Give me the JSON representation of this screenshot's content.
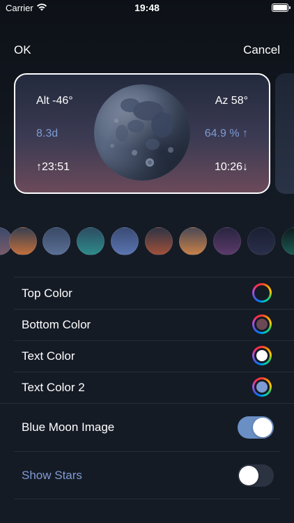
{
  "status_bar": {
    "carrier": "Carrier",
    "time": "19:48"
  },
  "nav": {
    "ok_label": "OK",
    "cancel_label": "Cancel"
  },
  "widget": {
    "altitude": "Alt -46°",
    "azimuth": "Az 58°",
    "moon_age": "8.3d",
    "illumination": "64.9 % ↑",
    "moonrise": "↑23:51",
    "moonset": "10:26↓"
  },
  "presets": [
    {
      "name": "preset-1",
      "top": "#3b4a6b",
      "bottom": "#7a5a6a"
    },
    {
      "name": "preset-2",
      "top": "#3a4050",
      "bottom": "#c26f3c"
    },
    {
      "name": "preset-3",
      "top": "#3a4a66",
      "bottom": "#5a6f95"
    },
    {
      "name": "preset-4",
      "top": "#2c4d62",
      "bottom": "#2e8a8a"
    },
    {
      "name": "preset-5",
      "top": "#3b4c75",
      "bottom": "#5a74b0"
    },
    {
      "name": "preset-6",
      "top": "#2f3444",
      "bottom": "#a0503a"
    },
    {
      "name": "preset-7",
      "top": "#4c4a55",
      "bottom": "#c88048"
    },
    {
      "name": "preset-8",
      "top": "#2a2540",
      "bottom": "#5a3a6a"
    },
    {
      "name": "preset-9",
      "top": "#1a1f33",
      "bottom": "#2a2f4a"
    },
    {
      "name": "preset-10",
      "top": "#0f1a1c",
      "bottom": "#1b5a52"
    }
  ],
  "settings": {
    "top_color": {
      "label": "Top Color",
      "value": "#151b25"
    },
    "bottom_color": {
      "label": "Bottom Color",
      "value": "#6b4a55"
    },
    "text_color": {
      "label": "Text Color",
      "value": "#ffffff"
    },
    "text_color_2": {
      "label": "Text Color 2",
      "value": "#7f9bd4"
    },
    "blue_moon_image": {
      "label": "Blue Moon Image",
      "on": true
    },
    "show_stars": {
      "label": "Show Stars",
      "on": false
    }
  }
}
